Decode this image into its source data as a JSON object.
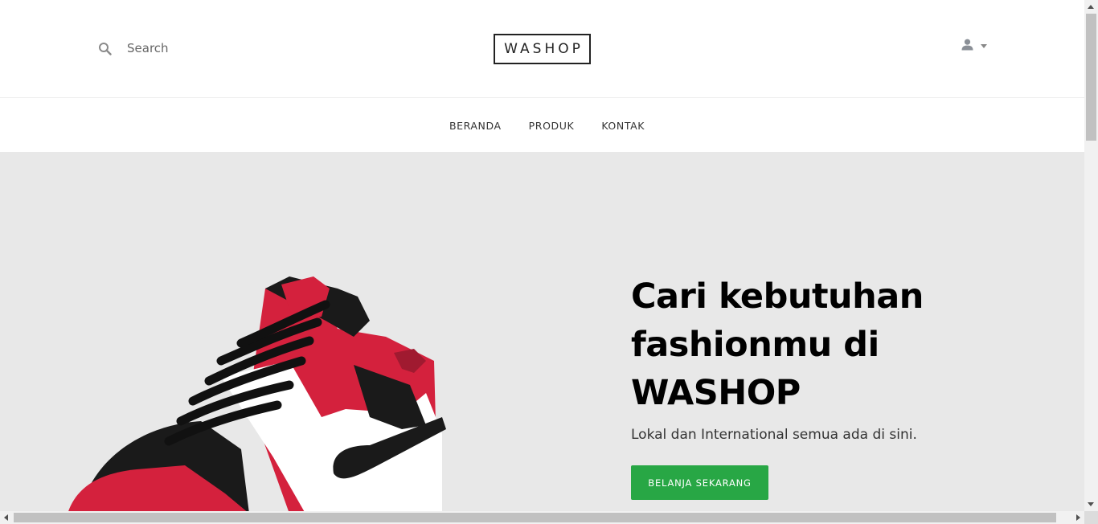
{
  "header": {
    "search": {
      "placeholder": "Search",
      "value": ""
    },
    "logo": "WASHOP",
    "user_menu": {
      "icon": "user-icon"
    }
  },
  "nav": {
    "items": [
      {
        "label": "BERANDA"
      },
      {
        "label": "PRODUK"
      },
      {
        "label": "KONTAK"
      }
    ]
  },
  "hero": {
    "title_lines": [
      "Cari kebutuhan",
      "fashionmu di",
      "WASHOP"
    ],
    "subtitle": "Lokal dan International semua ada di sini.",
    "cta_label": "BELANJA SEKARANG",
    "image": "sneaker-image"
  },
  "colors": {
    "hero_bg": "#e8e8e8",
    "cta_bg": "#28a745",
    "shoe_red": "#d4213d",
    "shoe_black": "#1a1a1a"
  }
}
